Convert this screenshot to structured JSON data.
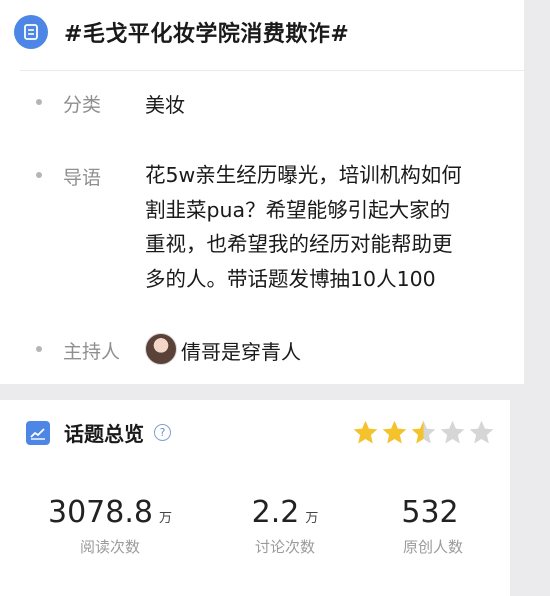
{
  "topic": {
    "title": "#毛戈平化妆学院消费欺诈#"
  },
  "details": {
    "category": {
      "label": "分类",
      "value": "美妆"
    },
    "intro": {
      "label": "导语",
      "lines": [
        "花5w亲生经历曝光，培训机构如何",
        "割韭菜pua？希望能够引起大家的",
        "重视，也希望我的经历对能帮助更",
        "多的人。带话题发博抽10人100"
      ]
    },
    "host": {
      "label": "主持人",
      "name": "倩哥是穿青人"
    }
  },
  "overview": {
    "title": "话题总览",
    "rating": 2.5,
    "rating_max": 5,
    "stats": [
      {
        "value": "3078.8",
        "unit": "万",
        "label": "阅读次数"
      },
      {
        "value": "2.2",
        "unit": "万",
        "label": "讨论次数"
      },
      {
        "value": "532",
        "unit": "",
        "label": "原创人数"
      }
    ]
  },
  "colors": {
    "accent": "#4e86e6",
    "star_filled": "#f4c22b",
    "star_empty": "#d6d6d6"
  }
}
